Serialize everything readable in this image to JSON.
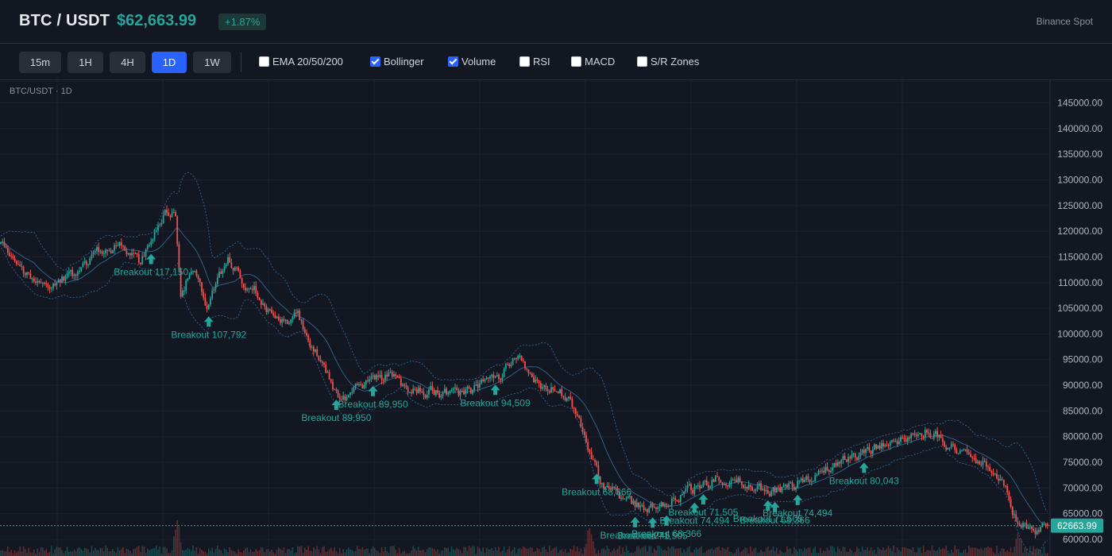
{
  "header": {
    "symbol": "BTC / USDT",
    "price": "$62,663.99",
    "change": "+1.87%",
    "exchange": "Binance Spot"
  },
  "toolbar": {
    "timeframes": [
      {
        "label": "15m",
        "active": false
      },
      {
        "label": "1H",
        "active": false
      },
      {
        "label": "4H",
        "active": false
      },
      {
        "label": "1D",
        "active": true
      },
      {
        "label": "1W",
        "active": false
      }
    ],
    "indicators": [
      {
        "label": "EMA 20/50/200",
        "checked": false
      },
      {
        "label": "Bollinger",
        "checked": true
      },
      {
        "label": "Volume",
        "checked": true
      },
      {
        "label": "RSI",
        "checked": false
      },
      {
        "label": "MACD",
        "checked": false
      },
      {
        "label": "S/R Zones",
        "checked": false
      }
    ]
  },
  "chart_label": "BTC/USDT · 1D",
  "colors": {
    "up": "#26a69a",
    "down": "#ef5350",
    "accent": "#2962ff",
    "background": "#131722",
    "grid": "#1e2230",
    "band": "#2f5f8a"
  },
  "chart_data": {
    "type": "candlestick",
    "ylim": [
      60000,
      147000
    ],
    "y_ticks": [
      "145000.00",
      "140000.00",
      "135000.00",
      "130000.00",
      "125000.00",
      "120000.00",
      "115000.00",
      "110000.00",
      "105000.00",
      "100000.00",
      "95000.00",
      "90000.00",
      "85000.00",
      "80000.00",
      "75000.00",
      "70000.00",
      "65000.00",
      "60000.00"
    ],
    "current_price": 62663.99,
    "current_price_label": "62663.99",
    "close_trend": [
      [
        0,
        117500
      ],
      [
        12,
        113000
      ],
      [
        20,
        110500
      ],
      [
        30,
        110000
      ],
      [
        45,
        112000
      ],
      [
        55,
        116000
      ],
      [
        70,
        117000
      ],
      [
        80,
        113000
      ],
      [
        85,
        118000
      ],
      [
        95,
        124000
      ],
      [
        100,
        123000
      ],
      [
        103,
        108500
      ],
      [
        110,
        112500
      ],
      [
        118,
        105000
      ],
      [
        130,
        115000
      ],
      [
        138,
        110500
      ],
      [
        145,
        109000
      ],
      [
        152,
        105000
      ],
      [
        160,
        102000
      ],
      [
        170,
        104000
      ],
      [
        182,
        95000
      ],
      [
        195,
        87000
      ],
      [
        210,
        91000
      ],
      [
        222,
        92000
      ],
      [
        232,
        89000
      ],
      [
        245,
        89000
      ],
      [
        265,
        88000
      ],
      [
        285,
        91500
      ],
      [
        295,
        96000
      ],
      [
        308,
        90000
      ],
      [
        320,
        88500
      ],
      [
        330,
        85000
      ],
      [
        337,
        77000
      ],
      [
        345,
        70000
      ],
      [
        360,
        67000
      ],
      [
        375,
        66000
      ],
      [
        385,
        68000
      ],
      [
        400,
        70500
      ],
      [
        412,
        72000
      ],
      [
        425,
        71000
      ],
      [
        440,
        69000
      ],
      [
        455,
        71000
      ],
      [
        470,
        73000
      ],
      [
        482,
        76000
      ],
      [
        495,
        77500
      ],
      [
        510,
        78500
      ],
      [
        522,
        80500
      ],
      [
        530,
        81500
      ],
      [
        540,
        79000
      ],
      [
        552,
        76000
      ],
      [
        562,
        74500
      ],
      [
        575,
        70000
      ],
      [
        582,
        63000
      ],
      [
        590,
        61500
      ],
      [
        599,
        62664
      ]
    ],
    "volatility_bursts": [
      [
        101,
        40
      ],
      [
        337,
        30
      ],
      [
        582,
        25
      ]
    ],
    "breakout_signals": [
      {
        "x": 86,
        "label": "Breakout 117,150"
      },
      {
        "x": 119,
        "label": "Breakout 107,792"
      },
      {
        "x": 192,
        "label": "Breakout 89,950"
      },
      {
        "x": 213,
        "label": "Breakout 89,950"
      },
      {
        "x": 283,
        "label": "Breakout 94,509"
      },
      {
        "x": 341,
        "label": "Breakout 68,366"
      },
      {
        "x": 363,
        "label": "Breakout 65,245"
      },
      {
        "x": 373,
        "label": "Breakout 71,505"
      },
      {
        "x": 381,
        "label": "Breakout 68,366"
      },
      {
        "x": 397,
        "label": "Breakout 74,494"
      },
      {
        "x": 402,
        "label": "Breakout 71,505"
      },
      {
        "x": 439,
        "label": "Breakout 71,505"
      },
      {
        "x": 443,
        "label": "Breakout 68,366"
      },
      {
        "x": 456,
        "label": "Breakout 74,494"
      },
      {
        "x": 494,
        "label": "Breakout 80,043"
      }
    ]
  }
}
